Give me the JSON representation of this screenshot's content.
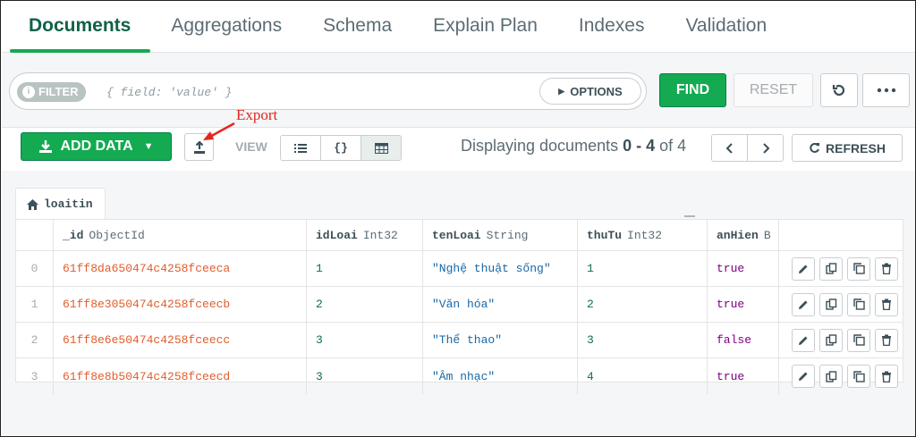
{
  "tabs": [
    {
      "label": "Documents"
    },
    {
      "label": "Aggregations"
    },
    {
      "label": "Schema"
    },
    {
      "label": "Explain Plan"
    },
    {
      "label": "Indexes"
    },
    {
      "label": "Validation"
    }
  ],
  "querybar": {
    "filter_label": "FILTER",
    "filter_placeholder": "{ field: 'value' }",
    "options_label": "OPTIONS",
    "find_label": "FIND",
    "reset_label": "RESET"
  },
  "toolbar": {
    "add_data_label": "ADD DATA",
    "view_label": "VIEW",
    "view_json_glyph": "{}",
    "display_prefix": "Displaying documents ",
    "display_range": "0 - 4",
    "display_of": " of ",
    "display_total": "4",
    "refresh_label": "REFRESH"
  },
  "annotation": {
    "label": "Export",
    "color": "#e3261f"
  },
  "collection": {
    "name": "loaitin"
  },
  "table": {
    "columns": [
      {
        "name": "_id",
        "type": "ObjectId"
      },
      {
        "name": "idLoai",
        "type": "Int32"
      },
      {
        "name": "tenLoai",
        "type": "String"
      },
      {
        "name": "thuTu",
        "type": "Int32"
      },
      {
        "name": "anHien",
        "type": "B"
      }
    ],
    "rows": [
      {
        "index": "0",
        "id": "61ff8da650474c4258fceeca",
        "idLoai": "1",
        "tenLoai": "\"Nghệ thuật sống\"",
        "thuTu": "1",
        "anHien": "true"
      },
      {
        "index": "1",
        "id": "61ff8e3050474c4258fceecb",
        "idLoai": "2",
        "tenLoai": "\"Văn hóa\"",
        "thuTu": "2",
        "anHien": "true"
      },
      {
        "index": "2",
        "id": "61ff8e6e50474c4258fceecc",
        "idLoai": "3",
        "tenLoai": "\"Thể thao\"",
        "thuTu": "3",
        "anHien": "false"
      },
      {
        "index": "3",
        "id": "61ff8e8b50474c4258fceecd",
        "idLoai": "3",
        "tenLoai": "\"Âm nhạc\"",
        "thuTu": "4",
        "anHien": "true"
      }
    ]
  },
  "colors": {
    "accent_green": "#13aa52",
    "active_tab_text": "#116149",
    "objectid": "#e35c2b",
    "number": "#126d4b",
    "string": "#1967a5",
    "boolean": "#800080"
  },
  "icons": {
    "filter_info": "info-icon",
    "options_caret": "caret-right-icon",
    "history": "history-icon",
    "more": "ellipsis-icon",
    "add_data": "download-icon",
    "export": "export-icon",
    "list_view": "list-icon",
    "json_view": "json-icon",
    "table_view": "table-icon",
    "prev": "chevron-left-icon",
    "next": "chevron-right-icon",
    "refresh": "refresh-icon",
    "collection": "home-icon",
    "edit": "pencil-icon",
    "copy": "copy-icon",
    "clone": "clone-icon",
    "delete": "trash-icon"
  }
}
